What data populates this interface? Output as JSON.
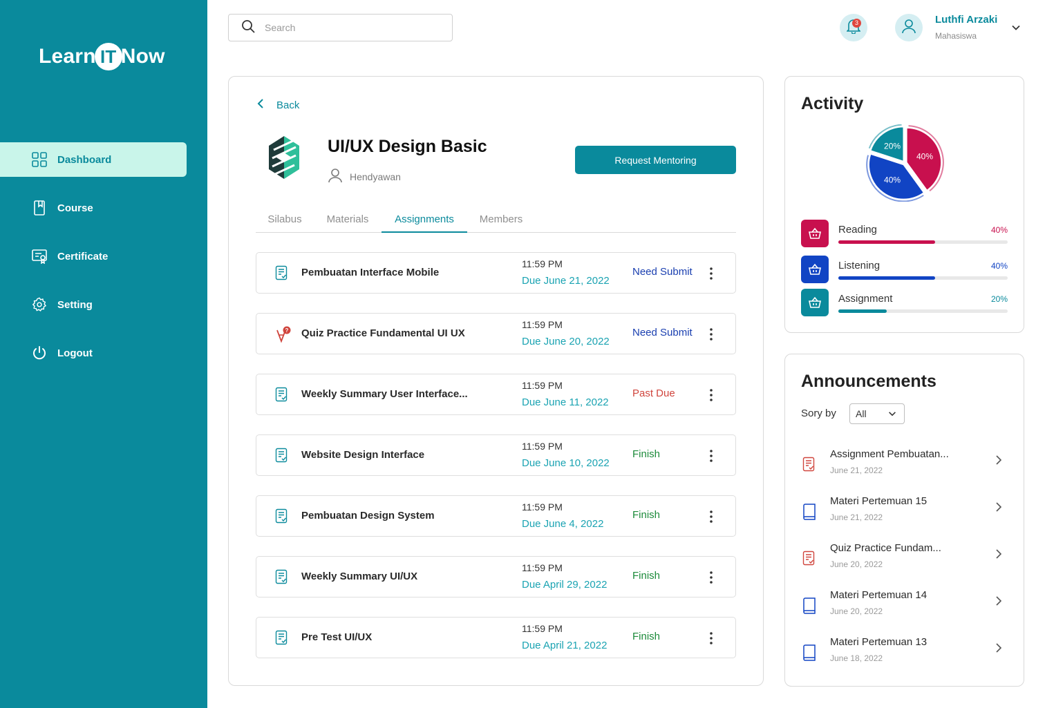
{
  "brand": {
    "part1": "Learn",
    "part2": "IT",
    "part3": "Now"
  },
  "sidebar": {
    "items": [
      {
        "label": "Dashboard",
        "icon": "grid-icon"
      },
      {
        "label": "Course",
        "icon": "book-icon"
      },
      {
        "label": "Certificate",
        "icon": "certificate-icon"
      },
      {
        "label": "Setting",
        "icon": "gear-icon"
      },
      {
        "label": "Logout",
        "icon": "power-icon"
      }
    ]
  },
  "search": {
    "placeholder": "Search"
  },
  "notifications": {
    "count": "3"
  },
  "user": {
    "name": "Luthfi Arzaki",
    "role": "Mahasiswa"
  },
  "course": {
    "back_label": "Back",
    "title": "UI/UX Design Basic",
    "mentor": "Hendyawan",
    "request_button": "Request Mentoring"
  },
  "tabs": [
    "Silabus",
    "Materials",
    "Assignments",
    "Members"
  ],
  "active_tab": "Assignments",
  "assignments": [
    {
      "title": "Pembuatan Interface Mobile",
      "time": "11:59 PM",
      "due": "Due June 21, 2022",
      "status": "Need Submit",
      "icon": "document-icon"
    },
    {
      "title": "Quiz Practice Fundamental UI UX",
      "time": "11:59 PM",
      "due": "Due June 20, 2022",
      "status": "Need Submit",
      "icon": "quiz-icon"
    },
    {
      "title": "Weekly Summary User Interface...",
      "time": "11:59 PM",
      "due": "Due June 11, 2022",
      "status": "Past Due",
      "icon": "document-icon"
    },
    {
      "title": "Website Design Interface",
      "time": "11:59 PM",
      "due": "Due June 10, 2022",
      "status": "Finish",
      "icon": "document-icon"
    },
    {
      "title": "Pembuatan Design System",
      "time": "11:59 PM",
      "due": "Due June 4, 2022",
      "status": "Finish",
      "icon": "document-icon"
    },
    {
      "title": "Weekly Summary UI/UX",
      "time": "11:59 PM",
      "due": "Due April 29, 2022",
      "status": "Finish",
      "icon": "document-icon"
    },
    {
      "title": "Pre Test UI/UX",
      "time": "11:59 PM",
      "due": "Due April 21, 2022",
      "status": "Finish",
      "icon": "document-icon"
    }
  ],
  "activity": {
    "title": "Activity",
    "items": [
      {
        "name": "Reading",
        "percent": "40%",
        "value": 40,
        "color": "#c8104e"
      },
      {
        "name": "Listening",
        "percent": "40%",
        "value": 40,
        "color": "#1144c4"
      },
      {
        "name": "Assignment",
        "percent": "20%",
        "value": 20,
        "color": "#0a8a9c"
      }
    ]
  },
  "announcements": {
    "title": "Announcements",
    "sort_label": "Sory by",
    "sort_value": "All",
    "items": [
      {
        "title": "Assignment Pembuatan...",
        "date": "June 21, 2022",
        "icon": "document-icon"
      },
      {
        "title": "Materi Pertemuan 15",
        "date": "June 21, 2022",
        "icon": "book-icon"
      },
      {
        "title": "Quiz Practice Fundam...",
        "date": "June 20, 2022",
        "icon": "document-icon"
      },
      {
        "title": "Materi Pertemuan 14",
        "date": "June 20, 2022",
        "icon": "book-icon"
      },
      {
        "title": "Materi Pertemuan 13",
        "date": "June 18, 2022",
        "icon": "book-icon"
      }
    ]
  },
  "colors": {
    "primary": "#0a8a9c",
    "active_bg": "#c9f5ea",
    "need_submit": "#1a3fb0",
    "past_due": "#d0453d",
    "finish": "#1c8a3a"
  }
}
